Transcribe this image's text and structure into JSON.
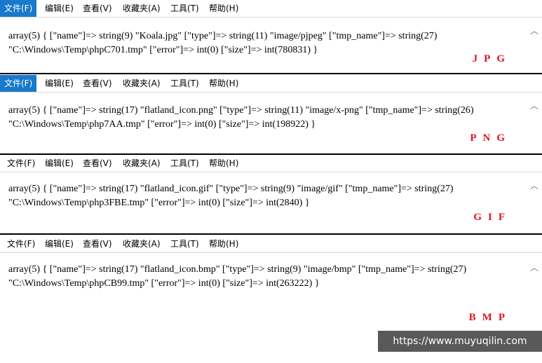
{
  "menu": [
    "文件(F)",
    "编辑(E)",
    "查看(V)",
    "收藏夹(A)",
    "工具(T)",
    "帮助(H)"
  ],
  "panels": [
    {
      "active_menu": true,
      "line1": "array(5) { [\"name\"]=> string(9) \"Koala.jpg\" [\"type\"]=> string(11) \"image/pjpeg\" [\"tmp_name\"]=> string(27)",
      "line2": "\"C:\\Windows\\Temp\\phpC701.tmp\" [\"error\"]=> int(0) [\"size\"]=> int(780831) }",
      "label": "JPG"
    },
    {
      "active_menu": true,
      "line1": "array(5) { [\"name\"]=> string(17) \"flatland_icon.png\" [\"type\"]=> string(11) \"image/x-png\" [\"tmp_name\"]=> string(26)",
      "line2": "\"C:\\Windows\\Temp\\php7AA.tmp\" [\"error\"]=> int(0) [\"size\"]=> int(198922) }",
      "label": "PNG"
    },
    {
      "active_menu": false,
      "line1": "array(5) { [\"name\"]=> string(17) \"flatland_icon.gif\" [\"type\"]=> string(9) \"image/gif\" [\"tmp_name\"]=> string(27)",
      "line2": "\"C:\\Windows\\Temp\\php3FBE.tmp\" [\"error\"]=> int(0) [\"size\"]=> int(2840) }",
      "label": "GIF"
    },
    {
      "active_menu": false,
      "line1": "array(5) { [\"name\"]=> string(17) \"flatland_icon.bmp\" [\"type\"]=> string(9) \"image/bmp\" [\"tmp_name\"]=> string(27)",
      "line2": "\"C:\\Windows\\Temp\\phpCB99.tmp\" [\"error\"]=> int(0) [\"size\"]=> int(263222) }",
      "label": "BMP"
    }
  ],
  "watermark": "https://www.muyuqilin.com",
  "colors": {
    "active_menu_bg": "#1979ca",
    "label_red": "#e0151c",
    "watermark_bg": "#595959"
  }
}
